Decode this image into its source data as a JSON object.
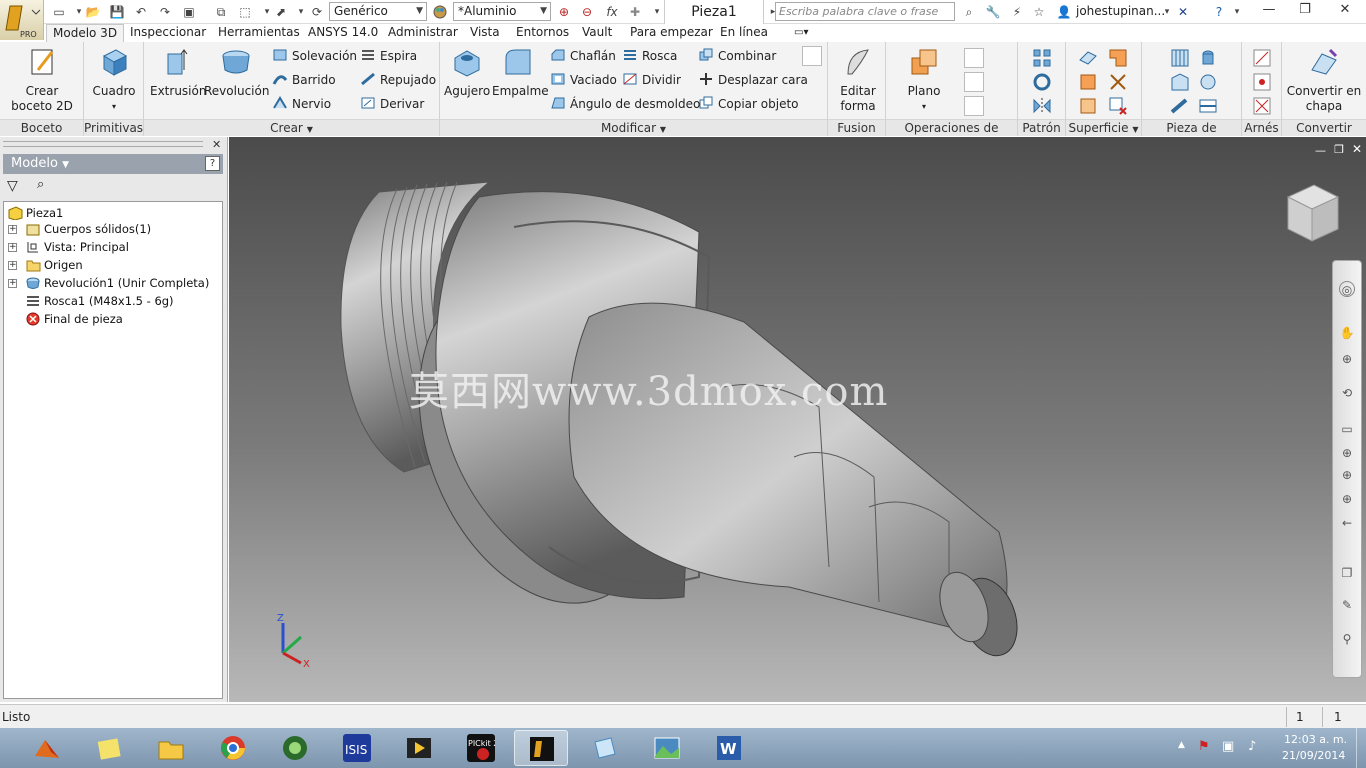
{
  "app": {
    "logo_text": "PRO"
  },
  "quick_access": {
    "style_select": "Genérico",
    "material_select": "*Aluminio",
    "function_label": "fx"
  },
  "document": {
    "title": "Pieza1"
  },
  "search": {
    "placeholder": "Escriba palabra clave o frase"
  },
  "user": {
    "name": "johestupinan..."
  },
  "window_controls": {
    "minimize": "—",
    "restore": "❐",
    "close": "✕"
  },
  "tabs": [
    {
      "label": "Modelo 3D",
      "active": true
    },
    {
      "label": "Inspeccionar"
    },
    {
      "label": "Herramientas"
    },
    {
      "label": "ANSYS 14.0"
    },
    {
      "label": "Administrar"
    },
    {
      "label": "Vista"
    },
    {
      "label": "Entornos"
    },
    {
      "label": "Vault"
    },
    {
      "label": "Para empezar"
    },
    {
      "label": "En línea"
    }
  ],
  "ribbon": {
    "boceto": {
      "label": "Boceto",
      "crear_boceto": "Crear\nboceto 2D"
    },
    "primitivas": {
      "label": "Primitivas",
      "cuadro": "Cuadro"
    },
    "crear": {
      "label": "Crear",
      "extrusion": "Extrusión",
      "revolucion": "Revolución",
      "solevacion": "Solevación",
      "barrido": "Barrido",
      "nervio": "Nervio",
      "espira": "Espira",
      "repujado": "Repujado",
      "derivar": "Derivar"
    },
    "modificar": {
      "label": "Modificar",
      "agujero": "Agujero",
      "empalme": "Empalme",
      "chaflan": "Chaflán",
      "vaciado": "Vaciado",
      "angulo": "Ángulo de desmoldeo",
      "rosca": "Rosca",
      "dividir": "Dividir",
      "combinar": "Combinar",
      "desplazar": "Desplazar cara",
      "copiar": "Copiar objeto"
    },
    "fusion": {
      "label": "Fusion",
      "editar": "Editar\nforma"
    },
    "operaciones": {
      "label": "Operaciones de trabajo",
      "plano": "Plano"
    },
    "patron": {
      "label": "Patrón"
    },
    "superficie": {
      "label": "Superficie"
    },
    "plastico": {
      "label": "Pieza de plástico"
    },
    "arnes": {
      "label": "Arnés"
    },
    "convertir": {
      "label": "Convertir",
      "chapa": "Convertir en\nchapa"
    }
  },
  "browser": {
    "title": "Modelo",
    "tree": [
      {
        "label": "Pieza1",
        "icon": "part-icon"
      },
      {
        "label": "Cuerpos sólidos(1)",
        "icon": "solid-bodies-icon"
      },
      {
        "label": "Vista: Principal",
        "icon": "view-icon"
      },
      {
        "label": "Origen",
        "icon": "folder-icon"
      },
      {
        "label": "Revolución1 (Unir Completa)",
        "icon": "revolve-icon"
      },
      {
        "label": "Rosca1 (M48x1.5 - 6g)",
        "icon": "thread-icon"
      },
      {
        "label": "Final de pieza",
        "icon": "end-of-part-icon"
      }
    ]
  },
  "viewport": {
    "watermark": "莫西网www.3dmox.com",
    "axis_labels": {
      "z": "Z",
      "x": "X"
    }
  },
  "status": {
    "text": "Listo",
    "count1": "1",
    "count2": "1"
  },
  "taskbar": {
    "apps": [
      "matlab-icon",
      "sticky-notes-icon",
      "file-explorer-icon",
      "chrome-icon",
      "camtasia-icon",
      "isis-icon",
      "video-editor-icon",
      "pickit2-icon",
      "inventor-icon",
      "paint-icon",
      "photo-icon",
      "word-icon"
    ],
    "time": "12:03 a. m.",
    "date": "21/09/2014",
    "pickit_label": "PICkit 2",
    "isis_label": "ISIS"
  },
  "colors": {
    "accent": "#1e5da9",
    "ribbon_bg": "#f3f3f3",
    "viewport_top": "#4b4b4b",
    "viewport_bottom": "#b8b8b8"
  }
}
